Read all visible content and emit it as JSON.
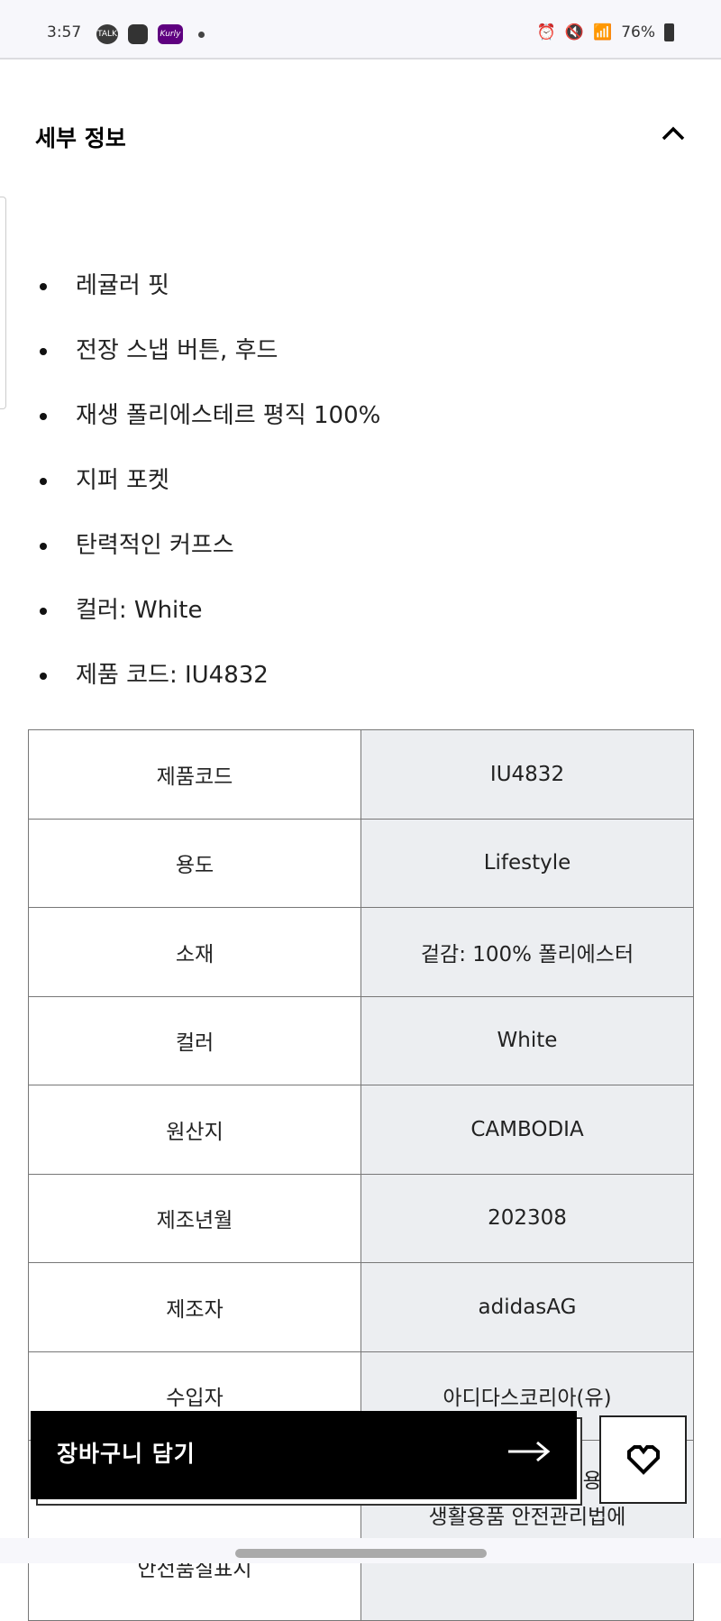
{
  "status_bar": {
    "time": "3:57",
    "notif_icons": [
      "kakaotalk-icon",
      "gallery-icon",
      "kurly-icon",
      "dot-icon"
    ],
    "kakao_label": "TALK",
    "kurly_label": "Kurly",
    "battery": "76%",
    "system_icons": [
      "alarm-icon",
      "mute-icon",
      "wifi-icon",
      "signal-icon",
      "battery-icon"
    ]
  },
  "section": {
    "title": "세부 정보",
    "expanded": true
  },
  "bullets": [
    "레귤러 핏",
    "전장 스냅 버튼, 후드",
    "재생 폴리에스테르 평직 100%",
    "지퍼 포켓",
    "탄력적인 커프스",
    "컬러: White",
    "제품 코드: IU4832"
  ],
  "spec_table": {
    "rows": [
      {
        "label": "제품코드",
        "value": "IU4832"
      },
      {
        "label": "용도",
        "value": "Lifestyle"
      },
      {
        "label": "소재",
        "value": "겉감: 100% 폴리에스터"
      },
      {
        "label": "컬러",
        "value": "White"
      },
      {
        "label": "원산지",
        "value": "CAMBODIA"
      },
      {
        "label": "제조년월",
        "value": "202308"
      },
      {
        "label": "제조자",
        "value": "adidasAG"
      },
      {
        "label": "수입자",
        "value": "아디다스코리아(유)"
      },
      {
        "label": "안전품질표시",
        "value_line1": "용품",
        "value_line2": "생활용품 안전관리법에"
      }
    ]
  },
  "actions": {
    "add_to_cart": "장바구니 담기",
    "wishlist_icon": "heart-icon",
    "arrow_icon": "arrow-right-icon"
  }
}
